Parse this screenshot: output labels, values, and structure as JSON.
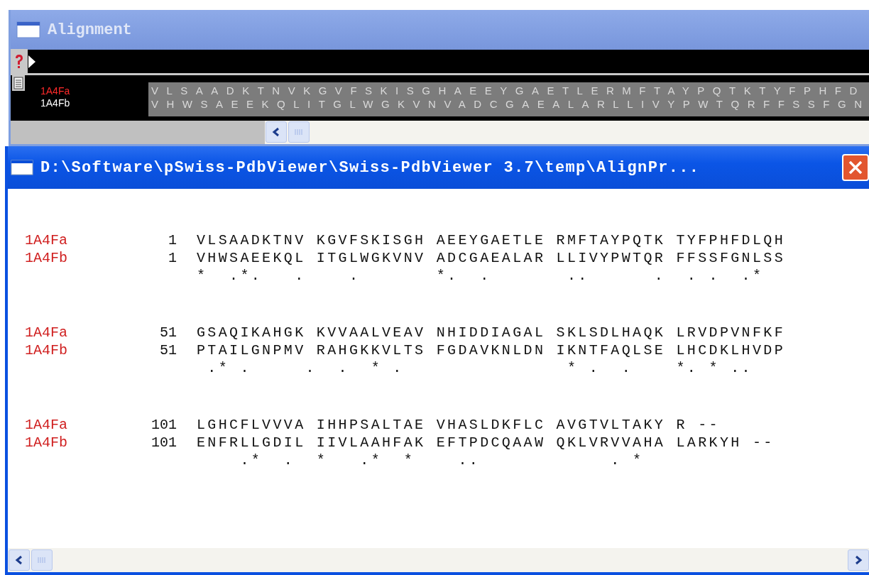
{
  "alignment_window": {
    "title": "Alignment",
    "sequences": [
      {
        "name": "1A4Fa",
        "color": "#ff2a2a",
        "residues": "VLSAADKTNVKGVFSKISGHAEEYGAETLERMFTAYPQTKTYFPHFD"
      },
      {
        "name": "1A4Fb",
        "color": "#ffffff",
        "residues": "VHWSAEEKQLITGLWGKVNVADCGAEALARLLIVYPWTQRFFSSFGN"
      }
    ]
  },
  "text_window": {
    "title": "D:\\Software\\pSwiss-PdbViewer\\Swiss-PdbViewer 3.7\\temp\\AlignPr...",
    "blocks": [
      {
        "rows": [
          {
            "name": "1A4Fa",
            "start": "1",
            "residues": "VLSAADKTNV KGVFSKISGH AEEYGAETLE RMFTAYPQTK TYFPHFDLQH"
          },
          {
            "name": "1A4Fb",
            "start": "1",
            "residues": "VHWSAEEKQL ITGLWGKVNV ADCGAEALAR LLIVYPWTQR FFSSFGNLSS"
          }
        ],
        "conservation": "*  .*.   .    .       *.  .       ..      .  . .  .*"
      },
      {
        "rows": [
          {
            "name": "1A4Fa",
            "start": "51",
            "residues": "GSAQIKAHGK KVVAALVEAV NHIDDIAGAL SKLSDLHAQK LRVDPVNFKF"
          },
          {
            "name": "1A4Fb",
            "start": "51",
            "residues": "PTAILGNPMV RAHGKKVLTS FGDAVKNLDN IKNTFAQLSE LHCDKLHVDP"
          }
        ],
        "conservation": " .* .     .  .  * .               * .  .    *. * .."
      },
      {
        "rows": [
          {
            "name": "1A4Fa",
            "start": "101",
            "residues": "LGHCFLVVVA IHHPSALTAE VHASLDKFLC AVGTVLTAKY R --"
          },
          {
            "name": "1A4Fb",
            "start": "101",
            "residues": "ENFRLLGDIL IIVLAAHFAK EFTPDCQAAW QKLVRVVAHA LARKYH --"
          }
        ],
        "conservation": "    .*  .  *   .*  *    ..            . *"
      }
    ]
  }
}
